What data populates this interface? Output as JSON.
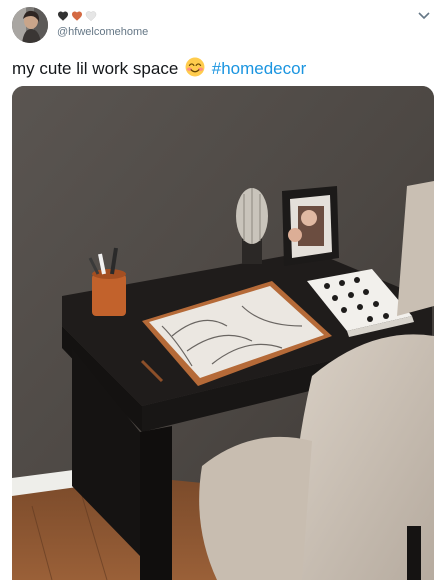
{
  "tweet": {
    "author": {
      "display_name_icons": [
        "black-heart-icon",
        "orange-heart-icon",
        "white-heart-icon"
      ],
      "handle": "@hfwelcomehome"
    },
    "text": "my cute lil work space",
    "emoji": "smiling-face-with-smiling-eyes-icon",
    "hashtag": "#homedecor",
    "media": {
      "kind": "photo",
      "subject": "desk-workspace"
    }
  },
  "colors": {
    "text": "#14171a",
    "muted": "#657786",
    "link": "#1b95e0",
    "heart_black": "#333333",
    "heart_orange": "#d46a43",
    "heart_white": "#e6e6e6"
  }
}
